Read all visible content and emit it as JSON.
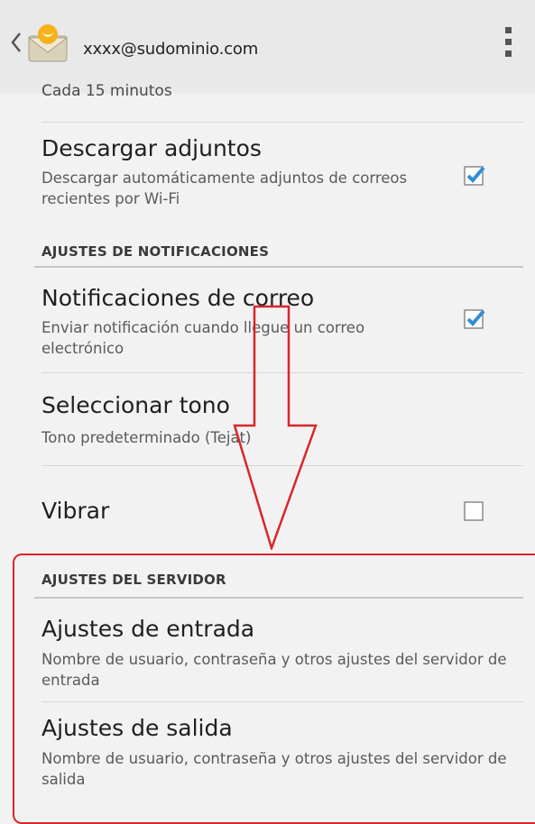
{
  "header": {
    "account": "xxxx@sudominio.com",
    "back_icon": "chevron-left-icon",
    "app_icon": "email-envelope-icon",
    "overflow_icon": "overflow-menu-icon"
  },
  "settings": {
    "sync_frequency_value": "Cada 15 minutos",
    "download_attachments": {
      "title": "Descargar adjuntos",
      "summary": "Descargar automáticamente adjuntos de correos recientes por Wi-Fi",
      "checked": true
    },
    "notifications_header": "AJUSTES DE NOTIFICACIONES",
    "mail_notifications": {
      "title": "Notificaciones de correo",
      "summary": "Enviar notificación cuando llegue un correo electrónico",
      "checked": true
    },
    "ringtone": {
      "title": "Seleccionar tono",
      "summary": "Tono predeterminado (Tejat)"
    },
    "vibrate": {
      "title": "Vibrar",
      "checked": false
    },
    "server_header": "AJUSTES DEL SERVIDOR",
    "incoming": {
      "title": "Ajustes de entrada",
      "summary": "Nombre de usuario, contraseña y otros ajustes del servidor de entrada"
    },
    "outgoing": {
      "title": "Ajustes de salida",
      "summary": "Nombre de usuario, contraseña y otros ajustes del servidor de salida"
    }
  },
  "colors": {
    "accent_check": "#2f8fd6",
    "annotation_red": "#d9262a",
    "background": "#f2f2f2"
  }
}
